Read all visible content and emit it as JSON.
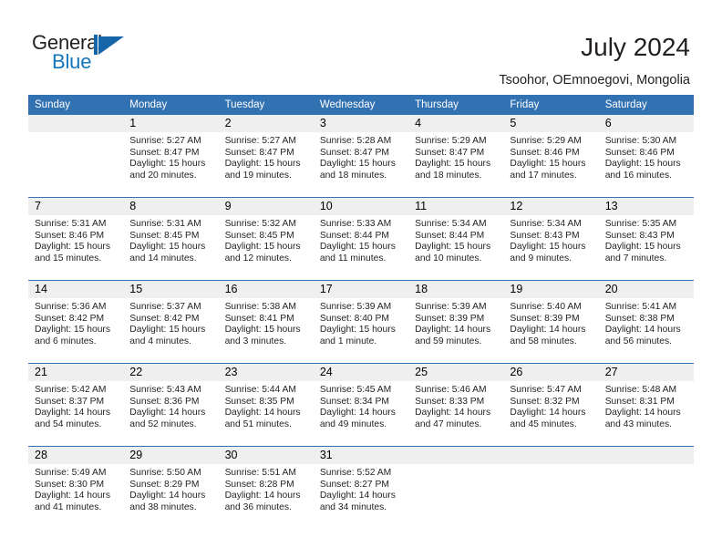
{
  "brand": {
    "name_part1": "General",
    "name_part2": "Blue",
    "logo_icon": "triangle-flag-icon",
    "accent_color": "#1565a8"
  },
  "header": {
    "title": "July 2024",
    "subtitle": "Tsoohor, OEmnoegovi, Mongolia"
  },
  "theme": {
    "header_blue": "#3372b2",
    "daynum_gray": "#efefef",
    "text_color": "#231f20"
  },
  "calendar": {
    "weekday_headers": [
      "Sunday",
      "Monday",
      "Tuesday",
      "Wednesday",
      "Thursday",
      "Friday",
      "Saturday"
    ],
    "weeks": [
      [
        {
          "day": "",
          "lines": []
        },
        {
          "day": "1",
          "lines": [
            "Sunrise: 5:27 AM",
            "Sunset: 8:47 PM",
            "Daylight: 15 hours",
            "and 20 minutes."
          ]
        },
        {
          "day": "2",
          "lines": [
            "Sunrise: 5:27 AM",
            "Sunset: 8:47 PM",
            "Daylight: 15 hours",
            "and 19 minutes."
          ]
        },
        {
          "day": "3",
          "lines": [
            "Sunrise: 5:28 AM",
            "Sunset: 8:47 PM",
            "Daylight: 15 hours",
            "and 18 minutes."
          ]
        },
        {
          "day": "4",
          "lines": [
            "Sunrise: 5:29 AM",
            "Sunset: 8:47 PM",
            "Daylight: 15 hours",
            "and 18 minutes."
          ]
        },
        {
          "day": "5",
          "lines": [
            "Sunrise: 5:29 AM",
            "Sunset: 8:46 PM",
            "Daylight: 15 hours",
            "and 17 minutes."
          ]
        },
        {
          "day": "6",
          "lines": [
            "Sunrise: 5:30 AM",
            "Sunset: 8:46 PM",
            "Daylight: 15 hours",
            "and 16 minutes."
          ]
        }
      ],
      [
        {
          "day": "7",
          "lines": [
            "Sunrise: 5:31 AM",
            "Sunset: 8:46 PM",
            "Daylight: 15 hours",
            "and 15 minutes."
          ]
        },
        {
          "day": "8",
          "lines": [
            "Sunrise: 5:31 AM",
            "Sunset: 8:45 PM",
            "Daylight: 15 hours",
            "and 14 minutes."
          ]
        },
        {
          "day": "9",
          "lines": [
            "Sunrise: 5:32 AM",
            "Sunset: 8:45 PM",
            "Daylight: 15 hours",
            "and 12 minutes."
          ]
        },
        {
          "day": "10",
          "lines": [
            "Sunrise: 5:33 AM",
            "Sunset: 8:44 PM",
            "Daylight: 15 hours",
            "and 11 minutes."
          ]
        },
        {
          "day": "11",
          "lines": [
            "Sunrise: 5:34 AM",
            "Sunset: 8:44 PM",
            "Daylight: 15 hours",
            "and 10 minutes."
          ]
        },
        {
          "day": "12",
          "lines": [
            "Sunrise: 5:34 AM",
            "Sunset: 8:43 PM",
            "Daylight: 15 hours",
            "and 9 minutes."
          ]
        },
        {
          "day": "13",
          "lines": [
            "Sunrise: 5:35 AM",
            "Sunset: 8:43 PM",
            "Daylight: 15 hours",
            "and 7 minutes."
          ]
        }
      ],
      [
        {
          "day": "14",
          "lines": [
            "Sunrise: 5:36 AM",
            "Sunset: 8:42 PM",
            "Daylight: 15 hours",
            "and 6 minutes."
          ]
        },
        {
          "day": "15",
          "lines": [
            "Sunrise: 5:37 AM",
            "Sunset: 8:42 PM",
            "Daylight: 15 hours",
            "and 4 minutes."
          ]
        },
        {
          "day": "16",
          "lines": [
            "Sunrise: 5:38 AM",
            "Sunset: 8:41 PM",
            "Daylight: 15 hours",
            "and 3 minutes."
          ]
        },
        {
          "day": "17",
          "lines": [
            "Sunrise: 5:39 AM",
            "Sunset: 8:40 PM",
            "Daylight: 15 hours",
            "and 1 minute."
          ]
        },
        {
          "day": "18",
          "lines": [
            "Sunrise: 5:39 AM",
            "Sunset: 8:39 PM",
            "Daylight: 14 hours",
            "and 59 minutes."
          ]
        },
        {
          "day": "19",
          "lines": [
            "Sunrise: 5:40 AM",
            "Sunset: 8:39 PM",
            "Daylight: 14 hours",
            "and 58 minutes."
          ]
        },
        {
          "day": "20",
          "lines": [
            "Sunrise: 5:41 AM",
            "Sunset: 8:38 PM",
            "Daylight: 14 hours",
            "and 56 minutes."
          ]
        }
      ],
      [
        {
          "day": "21",
          "lines": [
            "Sunrise: 5:42 AM",
            "Sunset: 8:37 PM",
            "Daylight: 14 hours",
            "and 54 minutes."
          ]
        },
        {
          "day": "22",
          "lines": [
            "Sunrise: 5:43 AM",
            "Sunset: 8:36 PM",
            "Daylight: 14 hours",
            "and 52 minutes."
          ]
        },
        {
          "day": "23",
          "lines": [
            "Sunrise: 5:44 AM",
            "Sunset: 8:35 PM",
            "Daylight: 14 hours",
            "and 51 minutes."
          ]
        },
        {
          "day": "24",
          "lines": [
            "Sunrise: 5:45 AM",
            "Sunset: 8:34 PM",
            "Daylight: 14 hours",
            "and 49 minutes."
          ]
        },
        {
          "day": "25",
          "lines": [
            "Sunrise: 5:46 AM",
            "Sunset: 8:33 PM",
            "Daylight: 14 hours",
            "and 47 minutes."
          ]
        },
        {
          "day": "26",
          "lines": [
            "Sunrise: 5:47 AM",
            "Sunset: 8:32 PM",
            "Daylight: 14 hours",
            "and 45 minutes."
          ]
        },
        {
          "day": "27",
          "lines": [
            "Sunrise: 5:48 AM",
            "Sunset: 8:31 PM",
            "Daylight: 14 hours",
            "and 43 minutes."
          ]
        }
      ],
      [
        {
          "day": "28",
          "lines": [
            "Sunrise: 5:49 AM",
            "Sunset: 8:30 PM",
            "Daylight: 14 hours",
            "and 41 minutes."
          ]
        },
        {
          "day": "29",
          "lines": [
            "Sunrise: 5:50 AM",
            "Sunset: 8:29 PM",
            "Daylight: 14 hours",
            "and 38 minutes."
          ]
        },
        {
          "day": "30",
          "lines": [
            "Sunrise: 5:51 AM",
            "Sunset: 8:28 PM",
            "Daylight: 14 hours",
            "and 36 minutes."
          ]
        },
        {
          "day": "31",
          "lines": [
            "Sunrise: 5:52 AM",
            "Sunset: 8:27 PM",
            "Daylight: 14 hours",
            "and 34 minutes."
          ]
        },
        {
          "day": "",
          "lines": []
        },
        {
          "day": "",
          "lines": []
        },
        {
          "day": "",
          "lines": []
        }
      ]
    ]
  }
}
